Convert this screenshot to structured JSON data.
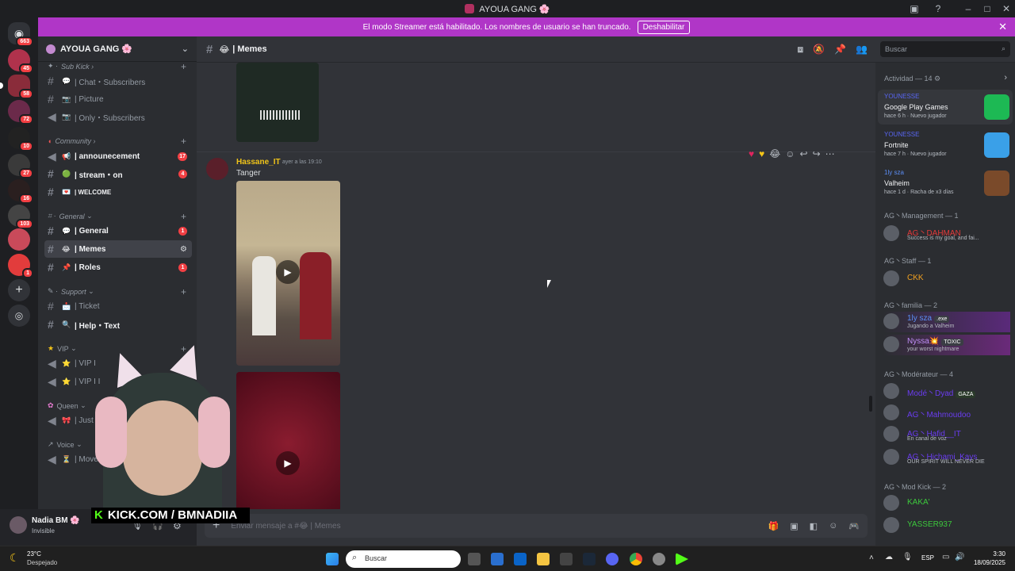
{
  "titlebar": {
    "title": "AYOUA GANG 🌸"
  },
  "banner": {
    "text": "El modo Streamer está habilitado. Los nombres de usuario se han truncado.",
    "button": "Deshabilitar"
  },
  "rail": {
    "home_badge": "663",
    "servers": [
      {
        "badge": "45",
        "color": "#b0324c"
      },
      {
        "badge": "58",
        "color": "#8a2c3a"
      },
      {
        "badge": "72",
        "color": "#6b2a4a"
      },
      {
        "badge": "10",
        "color": "#222"
      },
      {
        "badge": "27",
        "color": "#3a3a3a"
      },
      {
        "badge": "16",
        "color": "#2a1f1f"
      },
      {
        "badge": "103",
        "color": "#444"
      },
      {
        "badge": "",
        "color": "#c94a5a"
      },
      {
        "badge": "1",
        "color": "#e23c3c"
      }
    ]
  },
  "sidebar": {
    "server_name": "AYOUA GANG 🌸",
    "categories": [
      {
        "label": "Sub Kick"
      },
      {
        "label": "Community"
      },
      {
        "label": "General"
      },
      {
        "label": "Support"
      },
      {
        "label": "VIP"
      },
      {
        "label": "Queen"
      },
      {
        "label": "Voice"
      }
    ],
    "channels": [
      {
        "emoji": "💬",
        "label": "| Chat・Subscribers",
        "badge": ""
      },
      {
        "emoji": "📷",
        "label": "| Picture",
        "badge": ""
      },
      {
        "emoji": "📷",
        "label": "| Only・Subscribers",
        "badge": ""
      },
      {
        "emoji": "📢",
        "label": "| announecement",
        "badge": "17"
      },
      {
        "emoji": "🟢",
        "label": "| stream・on",
        "badge": "4"
      },
      {
        "emoji": "💌",
        "label": "| WELCOME",
        "badge": ""
      },
      {
        "emoji": "💬",
        "label": "| General",
        "badge": "1"
      },
      {
        "emoji": "😂",
        "label": "| Memes",
        "badge": ""
      },
      {
        "emoji": "📌",
        "label": "| Roles",
        "badge": "1"
      },
      {
        "emoji": "📩",
        "label": "| Ticket",
        "badge": ""
      },
      {
        "emoji": "🔍",
        "label": "| Help・Text",
        "badge": ""
      },
      {
        "emoji": "⭐",
        "label": "| VIP I",
        "badge": ""
      },
      {
        "emoji": "⭐",
        "label": "| VIP I I",
        "badge": ""
      },
      {
        "emoji": "🎀",
        "label": "| Just",
        "badge": ""
      },
      {
        "emoji": "⏳",
        "label": "| Move",
        "badge": ""
      }
    ]
  },
  "user": {
    "name": "Nadia BM 🌸",
    "status": "Invisible"
  },
  "overlay": {
    "text": "KICK.COM / BMNADIIA"
  },
  "channel_header": {
    "name": "| Memes",
    "search": "Buscar"
  },
  "message": {
    "author": "Hassane_IT",
    "time": "ayer a las 19:10",
    "text": "Tanger"
  },
  "composer": {
    "placeholder": "Enviar mensaje a #😂 | Memes"
  },
  "activity": {
    "title": "Actividad — 14",
    "items": [
      {
        "user": "YOUNESSE",
        "game": "Google Play Games",
        "meta": "hace 6 h · Nuevo jugador",
        "color": "#1db954"
      },
      {
        "user": "YOUNESSE",
        "game": "Fortnite",
        "meta": "hace 7 h · Nuevo jugador",
        "color": "#3aa0e8"
      },
      {
        "user": "1ly sza",
        "game": "Valheim",
        "meta": "hace 1 d · Racha de x3 días",
        "color": "#7a4a2a"
      }
    ]
  },
  "member_groups": [
    {
      "title": "AG丶Management — 1",
      "members": [
        {
          "name": "AG丶DAHMAN",
          "status": "Success is my goal, and fai...",
          "color": "#e33a3a"
        }
      ]
    },
    {
      "title": "AG丶Staff — 1",
      "members": [
        {
          "name": "CKK",
          "status": "",
          "color": "#f0a020"
        }
      ]
    },
    {
      "title": "AG丶familia — 2",
      "members": [
        {
          "name": "1ly sza",
          "status": "Jugando a Valheim",
          "tag": ".exe",
          "color": "#5b8df5"
        },
        {
          "name": "Nyssa💥",
          "status": "your worst nightmare",
          "tag": "TOXIC",
          "color": "#c08ef8"
        }
      ]
    },
    {
      "title": "AG丶Modérateur — 4",
      "members": [
        {
          "name": "Modé丶Dyad",
          "status": "",
          "tag": "GAZA",
          "color": "#6a3cf0"
        },
        {
          "name": "AG丶Mahmoudoo",
          "status": "",
          "color": "#6a3cf0"
        },
        {
          "name": "AG丶Hafid__IT",
          "status": "En canal de voz",
          "color": "#6a3cf0"
        },
        {
          "name": "AG丶Hichami_Kays",
          "status": "OUR SPIRIT WILL NEVER DIE",
          "color": "#6a3cf0"
        }
      ]
    },
    {
      "title": "AG丶Mod Kick — 2",
      "members": [
        {
          "name": "KAKA'",
          "status": "",
          "color": "#3cc83c"
        },
        {
          "name": "YASSER937",
          "status": "",
          "color": "#3cc83c"
        }
      ]
    }
  ],
  "taskbar": {
    "weather_temp": "23°C",
    "weather_desc": "Despejado",
    "search": "Buscar",
    "lang": "ESP",
    "time": "3:30",
    "date": "18/09/2025"
  }
}
